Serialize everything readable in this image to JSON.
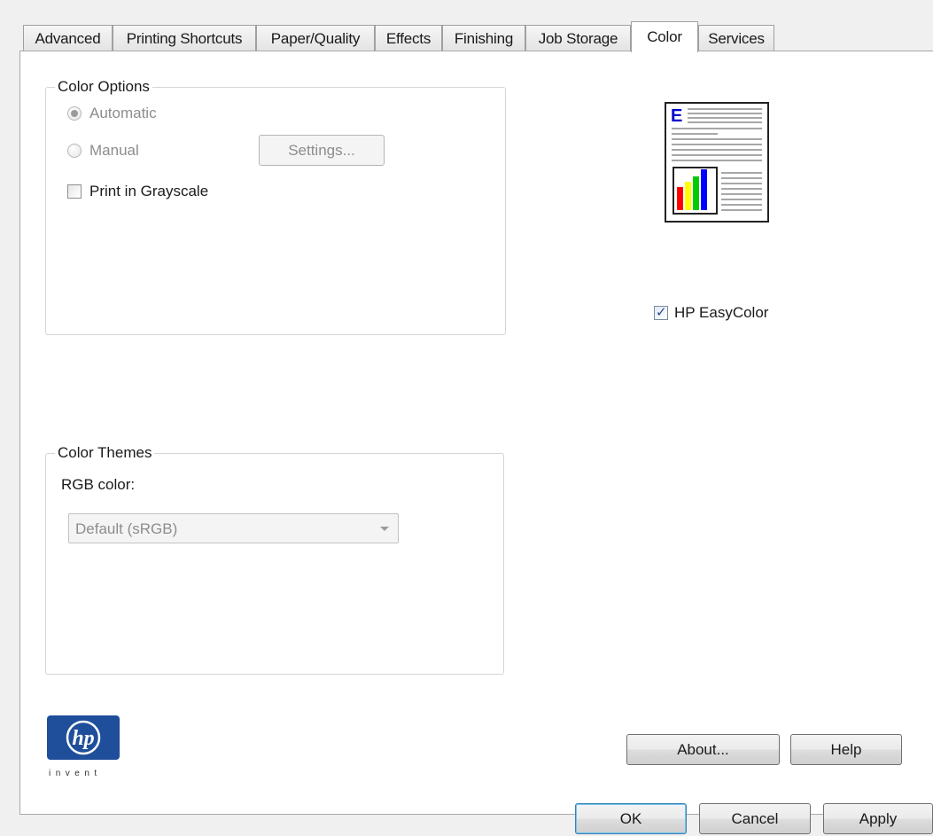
{
  "tabs": [
    {
      "label": "Advanced",
      "active": false
    },
    {
      "label": "Printing Shortcuts",
      "active": false
    },
    {
      "label": "Paper/Quality",
      "active": false
    },
    {
      "label": "Effects",
      "active": false
    },
    {
      "label": "Finishing",
      "active": false
    },
    {
      "label": "Job Storage",
      "active": false
    },
    {
      "label": "Color",
      "active": true
    },
    {
      "label": "Services",
      "active": false
    }
  ],
  "color_options": {
    "title": "Color Options",
    "automatic_label": "Automatic",
    "automatic_selected": true,
    "manual_label": "Manual",
    "settings_button": "Settings...",
    "grayscale_label": "Print in Grayscale",
    "grayscale_checked": false
  },
  "preview": {
    "letter": "E",
    "accent": "#0000cc",
    "bar_colors": [
      "#ff0000",
      "#ffff00",
      "#00cc00",
      "#0000ff"
    ]
  },
  "easycolor": {
    "label": "HP EasyColor",
    "checked": true
  },
  "color_themes": {
    "title": "Color Themes",
    "rgb_label": "RGB color:",
    "rgb_value": "Default (sRGB)"
  },
  "logo": {
    "mark": "hp",
    "tagline": "invent",
    "color": "#1f4f9b"
  },
  "panel_buttons": {
    "about": "About...",
    "help": "Help"
  },
  "dialog_buttons": {
    "ok": "OK",
    "cancel": "Cancel",
    "apply": "Apply"
  }
}
